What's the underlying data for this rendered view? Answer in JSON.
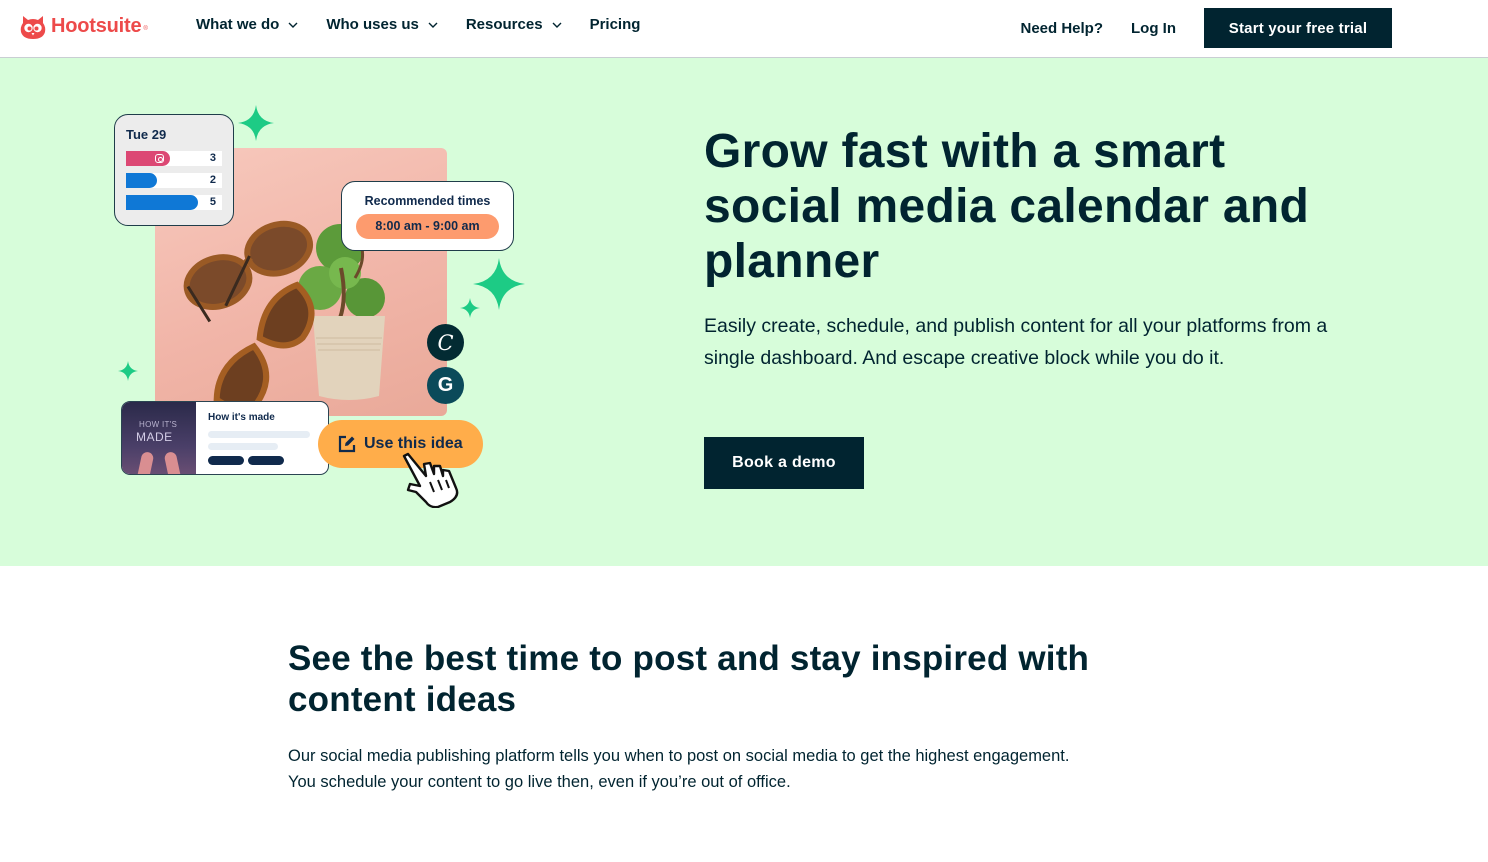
{
  "header": {
    "logo_text": "Hootsuite",
    "logo_reg": "®",
    "nav": [
      {
        "label": "What we do",
        "has_dropdown": true
      },
      {
        "label": "Who uses us",
        "has_dropdown": true
      },
      {
        "label": "Resources",
        "has_dropdown": true
      },
      {
        "label": "Pricing",
        "has_dropdown": false
      }
    ],
    "help_label": "Need Help?",
    "login_label": "Log In",
    "trial_label": "Start your free trial"
  },
  "hero": {
    "title": "Grow fast with a smart social media calendar and planner",
    "subtitle": "Easily create, schedule, and publish content for all your platforms from a single dashboard. And escape creative block while you do it.",
    "demo_label": "Book a demo",
    "illustration": {
      "calendar_card": {
        "date": "Tue 29",
        "bars": [
          {
            "platform": "instagram",
            "icon": "instagram-icon",
            "value": "3",
            "color": "#dc4874"
          },
          {
            "platform": "blue-network",
            "value": "2",
            "color": "#0f78d6"
          },
          {
            "platform": "blue-network",
            "value": "5",
            "color": "#0f78d6"
          }
        ]
      },
      "recommended_card": {
        "title": "Recommended times",
        "time": "8:00 am - 9:00 am"
      },
      "integrations": [
        {
          "name": "canva",
          "glyph": "C"
        },
        {
          "name": "grammarly",
          "glyph": "G"
        }
      ],
      "idea_card": {
        "thumb_line1": "HOW IT'S",
        "thumb_line2": "MADE",
        "title": "How it's made"
      },
      "idea_button_label": "Use this idea"
    }
  },
  "features": {
    "title": "See the best time to post and stay inspired with content ideas",
    "body": "Our social media publishing platform tells you when to post on social media to get the highest engagement. You schedule your content to go live then, even if you’re out of office."
  },
  "colors": {
    "brand": "#ed4a4a",
    "navy": "#012430",
    "hero_bg": "#d7fdda",
    "sparkle": "#1dcb85",
    "rec_time_bg": "#fd9b6e",
    "idea_button_bg": "#ffad4a"
  }
}
